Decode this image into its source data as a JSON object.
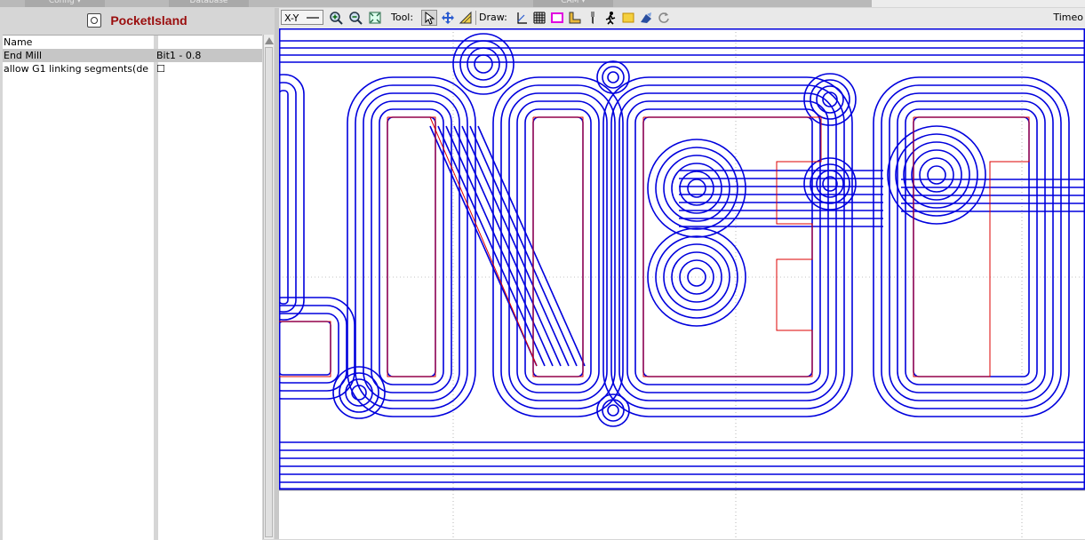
{
  "tabs": [
    {
      "label": "Config ▾"
    },
    {
      "label": "Database"
    },
    {
      "label": "CAM ▾"
    }
  ],
  "panel": {
    "title": "PocketIsland",
    "icon": "pocket-island-icon",
    "properties": [
      {
        "name": "Name",
        "value": ""
      },
      {
        "name": "End Mill",
        "value": "Bit1 - 0.8"
      },
      {
        "name": "allow G1 linking segments(de",
        "value": "☐"
      }
    ]
  },
  "toolbar": {
    "view_select": "X-Y",
    "tool_label": "Tool:",
    "draw_label": "Draw:",
    "right_text": "Timeo",
    "zoom_icons": [
      "zoom-in-icon",
      "zoom-out-icon",
      "zoom-fit-icon"
    ],
    "tool_icons": [
      "select-pointer-icon",
      "move-icon",
      "measure-icon"
    ],
    "draw_icons": [
      "draw-axis-icon",
      "grid-icon",
      "magenta-rect-icon",
      "ruler-icon",
      "tool-bit-icon",
      "runner-icon",
      "yellow-rect-icon",
      "blue-shape-icon",
      "refresh-icon"
    ]
  },
  "colors": {
    "toolpath": "#0000dd",
    "outline": "#dd0000",
    "title": "#9a0d0d",
    "grid": "#888888"
  }
}
